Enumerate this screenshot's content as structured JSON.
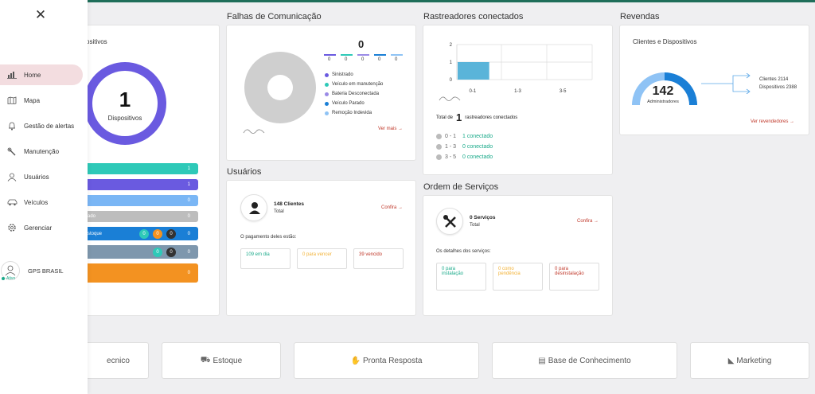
{
  "sidebar": {
    "close_icon": "close-icon",
    "items": [
      {
        "label": "Home",
        "icon": "chart-icon",
        "active": true
      },
      {
        "label": "Mapa",
        "icon": "map-icon"
      },
      {
        "label": "Gestão de alertas",
        "icon": "bell-icon"
      },
      {
        "label": "Manutenção",
        "icon": "wrench-icon"
      },
      {
        "label": "Usuários",
        "icon": "user-icon"
      },
      {
        "label": "Veículos",
        "icon": "car-icon"
      },
      {
        "label": "Gerenciar",
        "icon": "gear-icon"
      }
    ],
    "account": {
      "name": "GPS BRASIL",
      "status": "Ativo"
    }
  },
  "devices_card": {
    "title_fragment": "ositivos",
    "donut_value": "1",
    "donut_label": "Dispositivos",
    "bars": [
      {
        "label": "",
        "value": "1",
        "color": "#2ec9b8"
      },
      {
        "label": "",
        "value": "1",
        "color": "#6a5ae0"
      },
      {
        "label": "",
        "value": "0",
        "color": "#7ab6f5"
      },
      {
        "label": "ado",
        "value": "0",
        "color": "#bdbdbd"
      },
      {
        "label": "stoque",
        "value": "0",
        "color": "#1a7fd6",
        "pills": [
          "0",
          "0",
          "0"
        ]
      },
      {
        "label": "",
        "value": "0",
        "color": "#7e97ad",
        "pills": [
          "0",
          "0"
        ]
      },
      {
        "label": "",
        "value": "0",
        "color": "#f39221"
      }
    ]
  },
  "falhas": {
    "section_title": "Falhas de Comunicação",
    "total": "0",
    "mini_values": [
      "0",
      "0",
      "0",
      "0",
      "0"
    ],
    "mini_colors": [
      "#6a5ae0",
      "#2ec9b8",
      "#9a8be6",
      "#1a7fd6",
      "#8fc3f5"
    ],
    "legend": [
      {
        "label": "Sinistrado",
        "color": "#6a5ae0"
      },
      {
        "label": "Veículo em manutenção",
        "color": "#2ec9b8"
      },
      {
        "label": "Bateria Desconectada",
        "color": "#9a8be6"
      },
      {
        "label": "Veículo Parado",
        "color": "#1a7fd6"
      },
      {
        "label": "Remoção Indevida",
        "color": "#8fc3f5"
      }
    ],
    "more_link": "Ver mais →"
  },
  "rastreadores": {
    "section_title": "Rastreadores conectados",
    "chart_data": {
      "type": "bar",
      "categories": [
        "0-1",
        "1-3",
        "3-5"
      ],
      "values": [
        1,
        0,
        0
      ],
      "yticks": [
        "0",
        "1",
        "2"
      ],
      "ylim": [
        0,
        2
      ],
      "color": "#5ab4d9"
    },
    "total_prefix": "Total de",
    "total_value": "1",
    "total_suffix": "rastreadores conectados",
    "rows": [
      {
        "range": "0 - 1",
        "status": "1 conectado"
      },
      {
        "range": "1 - 3",
        "status": "0 conectado"
      },
      {
        "range": "3 - 5",
        "status": "0 conectado"
      }
    ]
  },
  "revendas": {
    "section_title": "Revendas",
    "card_title": "Clientes e Dispositivos",
    "gauge_value": "142",
    "gauge_label": "Administradores",
    "clientes": "Clientes 2114",
    "dispositivos": "Dispositivos 2388",
    "link": "Ver revendedores →"
  },
  "usuarios": {
    "section_title": "Usuários",
    "clients": "148 Clientes",
    "total_label": "Total",
    "confira": "Confira →",
    "payment_label": "O pagamento deles estão:",
    "stats": [
      {
        "text": "109 em dia",
        "color": "#1aaa8a"
      },
      {
        "text": "0 para vencer",
        "color": "#f2b134"
      },
      {
        "text": "39 vencido",
        "color": "#c0392b"
      }
    ]
  },
  "ordem": {
    "section_title": "Ordem de Serviços",
    "services": "0 Serviços",
    "total_label": "Total",
    "confira": "Confira →",
    "details_label": "Os detalhes dos serviços:",
    "stats": [
      {
        "line1": "0 para",
        "line2": "instalação",
        "color": "#1aaa8a"
      },
      {
        "line1": "0 como",
        "line2": "pendência",
        "color": "#f2b134"
      },
      {
        "line1": "0 para",
        "line2": "desinstalação",
        "color": "#c0392b"
      }
    ]
  },
  "bottom": [
    {
      "label": "ecnico",
      "icon": ""
    },
    {
      "label": "Estoque",
      "icon": "truck-icon"
    },
    {
      "label": "Pronta Resposta",
      "icon": "hand-icon"
    },
    {
      "label": "Base de Conhecimento",
      "icon": "file-icon"
    },
    {
      "label": "Marketing",
      "icon": "megaphone-icon"
    }
  ]
}
